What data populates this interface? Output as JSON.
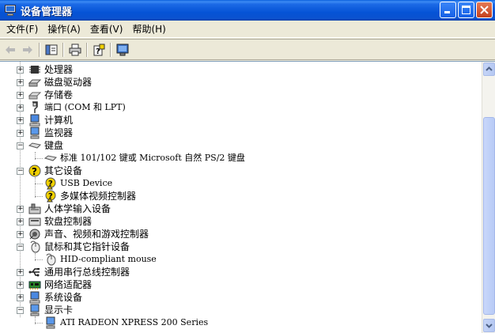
{
  "window": {
    "title": "设备管理器"
  },
  "menu": [
    {
      "label": "文件(F)"
    },
    {
      "label": "操作(A)"
    },
    {
      "label": "查看(V)"
    },
    {
      "label": "帮助(H)"
    }
  ],
  "toolbar": {
    "back_icon": "back-arrow-icon",
    "forward_icon": "forward-arrow-icon",
    "properties_icon": "properties-icon",
    "print_icon": "printer-icon",
    "help_icon": "help-icon",
    "scan_icon": "scan-hardware-icon"
  },
  "tree": [
    {
      "label": "处理器"
    },
    {
      "label": "磁盘驱动器"
    },
    {
      "label": "存储卷"
    },
    {
      "label": "端口 (COM 和 LPT)"
    },
    {
      "label": "计算机"
    },
    {
      "label": "监视器"
    },
    {
      "label": "键盘"
    },
    {
      "label": "标准 101/102 键或 Microsoft 自然 PS/2 键盘"
    },
    {
      "label": "其它设备"
    },
    {
      "label": "USB Device"
    },
    {
      "label": "多媒体视频控制器"
    },
    {
      "label": "人体学输入设备"
    },
    {
      "label": "软盘控制器"
    },
    {
      "label": "声音、视频和游戏控制器"
    },
    {
      "label": "鼠标和其它指针设备"
    },
    {
      "label": "HID-compliant mouse"
    },
    {
      "label": "通用串行总线控制器"
    },
    {
      "label": "网络适配器"
    },
    {
      "label": "系统设备"
    },
    {
      "label": "显示卡"
    },
    {
      "label": "ATI RADEON XPRESS 200 Series"
    }
  ],
  "colors": {
    "titlebar": "#0553d6",
    "selection": "#316ac5",
    "warning": "#f0d000"
  }
}
